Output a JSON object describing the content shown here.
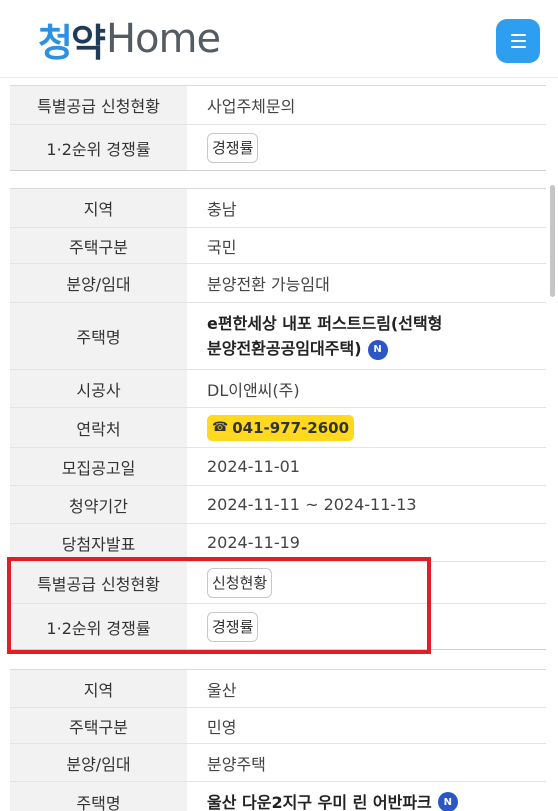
{
  "header": {
    "logo_ko_1": "청",
    "logo_ko_2": "약",
    "logo_en": "Home",
    "menu_icon": "hamburger-icon",
    "menu_color": "#2e9ff0"
  },
  "block_top": [
    {
      "label": "특별공급 신청현황",
      "value": "사업주체문의",
      "type": "text"
    },
    {
      "label": "1·2순위 경쟁률",
      "value": "경쟁률",
      "type": "button"
    }
  ],
  "block_main": [
    {
      "label": "지역",
      "value": "충남"
    },
    {
      "label": "주택구분",
      "value": "국민"
    },
    {
      "label": "분양/임대",
      "value": "분양전환 가능임대"
    },
    {
      "label": "주택명",
      "value_line1": "e편한세상 내포 퍼스트드림(선택형",
      "value_line2": "분양전환공공임대주택)",
      "badge": "N"
    },
    {
      "label": "시공사",
      "value": "DL이앤씨(주)"
    },
    {
      "label": "연락처",
      "phone_icon": "☎",
      "value": "041-977-2600",
      "phone_color": "#ffd91f"
    },
    {
      "label": "모집공고일",
      "value": "2024-11-01"
    },
    {
      "label": "청약기간",
      "value": "2024-11-11 ~ 2024-11-13"
    },
    {
      "label": "당첨자발표",
      "value": "2024-11-19"
    },
    {
      "label": "특별공급 신청현황",
      "value": "신청현황"
    },
    {
      "label": "1·2순위 경쟁률",
      "value": "경쟁률"
    }
  ],
  "block_bottom": [
    {
      "label": "지역",
      "value": "울산"
    },
    {
      "label": "주택구분",
      "value": "민영"
    },
    {
      "label": "분양/임대",
      "value": "분양주택"
    },
    {
      "label": "주택명",
      "value": "울산 다운2지구 우미 린 어반파크",
      "badge": "N"
    }
  ],
  "highlight_color": "#e01e26"
}
